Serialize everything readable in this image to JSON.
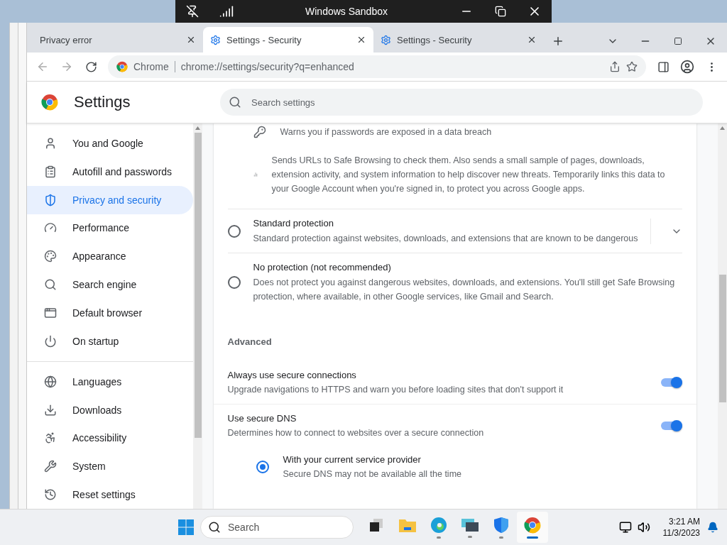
{
  "sandbox": {
    "title": "Windows Sandbox"
  },
  "tabs": [
    {
      "title": "Privacy error",
      "selected": false,
      "kind": "plain"
    },
    {
      "title": "Settings - Security",
      "selected": true,
      "kind": "settings"
    },
    {
      "title": "Settings - Security",
      "selected": false,
      "kind": "settings"
    }
  ],
  "omnibox": {
    "chip": "Chrome",
    "url": "chrome://settings/security?q=enhanced"
  },
  "settings": {
    "title": "Settings",
    "search_placeholder": "Search settings"
  },
  "sidebar": {
    "sections": [
      {
        "items": [
          {
            "label": "You and Google",
            "selected": false
          },
          {
            "label": "Autofill and passwords",
            "selected": false
          },
          {
            "label": "Privacy and security",
            "selected": true
          },
          {
            "label": "Performance",
            "selected": false
          },
          {
            "label": "Appearance",
            "selected": false
          },
          {
            "label": "Search engine",
            "selected": false
          },
          {
            "label": "Default browser",
            "selected": false
          },
          {
            "label": "On startup",
            "selected": false
          }
        ]
      },
      {
        "items": [
          {
            "label": "Languages",
            "selected": false
          },
          {
            "label": "Downloads",
            "selected": false
          },
          {
            "label": "Accessibility",
            "selected": false
          },
          {
            "label": "System",
            "selected": false
          },
          {
            "label": "Reset settings",
            "selected": false
          }
        ]
      }
    ]
  },
  "features": [
    {
      "kind": "key",
      "text": "Warns you if passwords are exposed in a data breach"
    },
    {
      "kind": "chart",
      "text": "Sends URLs to Safe Browsing to check them. Also sends a small sample of pages, downloads, extension activity, and system information to help discover new threats. Temporarily links this data to your Google Account when you're signed in, to protect you across Google apps."
    }
  ],
  "protection_options": [
    {
      "title": "Standard protection",
      "description": "Standard protection against websites, downloads, and extensions that are known to be dangerous",
      "selected": false,
      "expandable": true
    },
    {
      "title": "No protection (not recommended)",
      "description": "Does not protect you against dangerous websites, downloads, and extensions. You'll still get Safe Browsing protection, where available, in other Google services, like Gmail and Search.",
      "selected": false,
      "expandable": false
    }
  ],
  "advanced": {
    "heading": "Advanced",
    "toggles": [
      {
        "title": "Always use secure connections",
        "description": "Upgrade navigations to HTTPS and warn you before loading sites that don't support it",
        "on": true
      },
      {
        "title": "Use secure DNS",
        "description": "Determines how to connect to websites over a secure connection",
        "on": true
      }
    ],
    "dns_options": [
      {
        "title": "With your current service provider",
        "description": "Secure DNS may not be available all the time",
        "selected": true
      }
    ]
  },
  "taskbar": {
    "search_placeholder": "Search",
    "apps": [
      {
        "kind": "taskview",
        "running": false,
        "active": false
      },
      {
        "kind": "folder",
        "running": false,
        "active": false
      },
      {
        "kind": "edge",
        "running": true,
        "active": false
      },
      {
        "kind": "remote",
        "running": true,
        "active": false
      },
      {
        "kind": "shield",
        "running": true,
        "active": false
      },
      {
        "kind": "chrome",
        "running": true,
        "active": true
      }
    ],
    "time": "3:21 AM",
    "date": "11/3/2023"
  }
}
